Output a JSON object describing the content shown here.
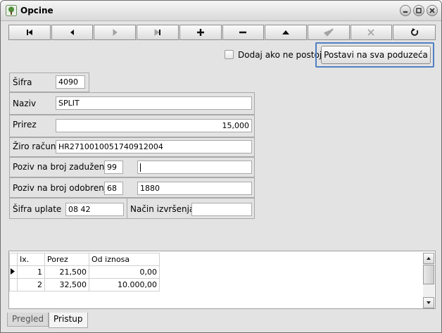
{
  "window": {
    "title": "Opcine"
  },
  "toolbar": {
    "buttons": [
      {
        "name": "first-record-button",
        "icon": "first-icon",
        "enabled": true
      },
      {
        "name": "prev-record-button",
        "icon": "prev-icon",
        "enabled": true
      },
      {
        "name": "next-record-button",
        "icon": "next-icon",
        "enabled": false
      },
      {
        "name": "last-record-button",
        "icon": "last-icon",
        "enabled": false
      },
      {
        "name": "add-record-button",
        "icon": "plus-icon",
        "enabled": true
      },
      {
        "name": "delete-record-button",
        "icon": "minus-icon",
        "enabled": true
      },
      {
        "name": "edit-record-button",
        "icon": "triangle-up-icon",
        "enabled": true
      },
      {
        "name": "confirm-button",
        "icon": "check-icon",
        "enabled": false
      },
      {
        "name": "cancel-button",
        "icon": "x-icon",
        "enabled": false
      },
      {
        "name": "refresh-button",
        "icon": "refresh-icon",
        "enabled": true
      }
    ]
  },
  "options": {
    "add_if_missing_label": "Dodaj ako ne postoji",
    "add_if_missing_checked": false,
    "apply_all_button": "Postavi na sva poduzeća",
    "highlight_color": "#4f7fc4"
  },
  "form": {
    "sifra": {
      "label": "Šifra",
      "value": "4090"
    },
    "naziv": {
      "label": "Naziv",
      "value": "SPLIT"
    },
    "prirez": {
      "label": "Prirez",
      "value": "15,000"
    },
    "ziro": {
      "label": "Žiro račun",
      "value": "HR2710010051740912004"
    },
    "poziv_zaduzenja": {
      "label": "Poziv na broj zaduženja",
      "model": "99",
      "value": ""
    },
    "poziv_odobrenja": {
      "label": "Poziv na broj odobrenja",
      "model": "68",
      "value": "1880"
    },
    "sifra_uplate": {
      "label": "Šifra uplate",
      "value": "08 42"
    },
    "nacin_izvrsenja": {
      "label": "Način izvršenja",
      "value": ""
    }
  },
  "grid": {
    "columns": [
      "Ix.",
      "Porez",
      "Od iznosa"
    ],
    "rows": [
      {
        "ix": "1",
        "porez": "21,500",
        "od_iznosa": "0,00",
        "current": true
      },
      {
        "ix": "2",
        "porez": "32,500",
        "od_iznosa": "10.000,00",
        "current": false
      }
    ]
  },
  "tabs": [
    {
      "label": "Pregled",
      "active": false
    },
    {
      "label": "Pristup",
      "active": true
    }
  ]
}
